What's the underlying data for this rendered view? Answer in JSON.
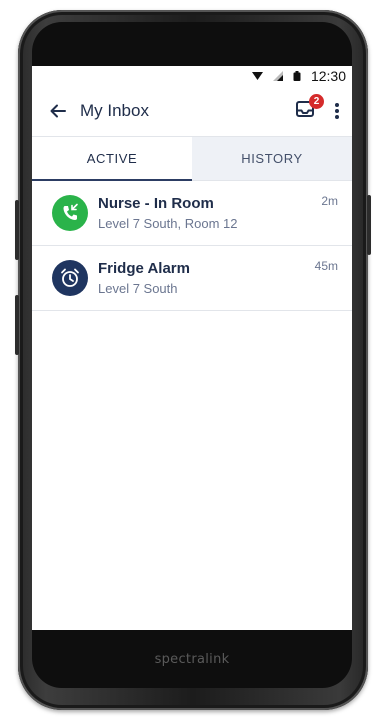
{
  "device": {
    "brand": "spectralink"
  },
  "status_bar": {
    "time": "12:30",
    "icons": [
      "wifi-icon",
      "signal-icon",
      "battery-icon"
    ]
  },
  "app_bar": {
    "title": "My Inbox",
    "badge_count": "2"
  },
  "tabs": [
    {
      "label": "ACTIVE",
      "selected": true
    },
    {
      "label": "HISTORY",
      "selected": false
    }
  ],
  "alerts": [
    {
      "title": "Nurse - In Room",
      "location": "Level 7 South, Room 12",
      "time": "2m",
      "icon": "nurse-call-icon",
      "color": "#2ab34a"
    },
    {
      "title": "Fridge Alarm",
      "location": "Level 7 South",
      "time": "45m",
      "icon": "alarm-clock-icon",
      "color": "#1f3560"
    }
  ]
}
